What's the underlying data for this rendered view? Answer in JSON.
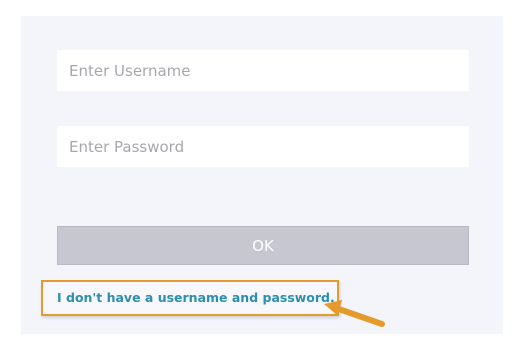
{
  "login_form": {
    "username_placeholder": "Enter Username",
    "password_placeholder": "Enter Password",
    "ok_label": "OK",
    "help_link_text": "I don't have a username and password."
  },
  "colors": {
    "panel_background": "#f4f4fb",
    "button_background": "#c7c7d1",
    "link_color": "#2b8fae",
    "highlight_color": "#e59a2c"
  },
  "annotation": {
    "highlight_icon": "arrow-pointer-icon"
  }
}
